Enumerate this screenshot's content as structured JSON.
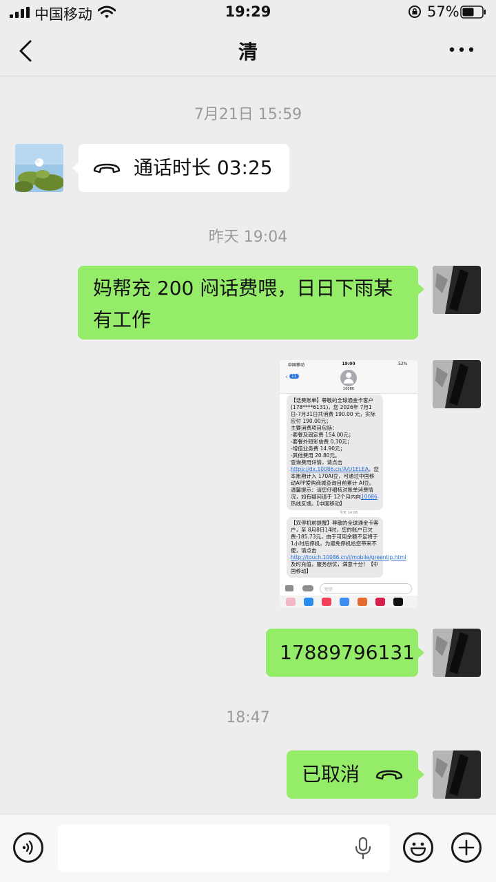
{
  "status_bar": {
    "carrier": "中国移动",
    "time": "19:29",
    "battery": "57%"
  },
  "header": {
    "title": "清"
  },
  "messages": [
    {
      "type": "timestamp",
      "text": "7月21日 15:59"
    },
    {
      "type": "call",
      "side": "left",
      "text": "通话时长 03:25",
      "icon": "phone-hangup-icon"
    },
    {
      "type": "timestamp",
      "text": "昨天 19:04"
    },
    {
      "type": "text",
      "side": "right",
      "text": "妈帮充 200 闷话费喂，日日下雨某有工作"
    },
    {
      "type": "image",
      "side": "right"
    },
    {
      "type": "text",
      "side": "right",
      "text": "17889796131"
    },
    {
      "type": "timestamp",
      "text": "18:47"
    },
    {
      "type": "call",
      "side": "right",
      "text": "已取消",
      "icon": "phone-hangup-icon"
    }
  ],
  "embedded_screenshot": {
    "status_carrier": "中国移动",
    "status_time": "19:00",
    "status_battery": "52%",
    "back_count": "11",
    "contact": "10086",
    "sms1_a": "【话费账单】尊敬的全球通金卡客户 (178****6131)，您 2026年 7月1日-7月31日共消费 190.00 元，实际应付 190.00元；",
    "sms1_b": "主要消费项目包括：",
    "sms1_c": "-套餐及固定费 154.00元；",
    "sms1_d": "-套餐外短彩信费 0.30元；",
    "sms1_e": "-增值业务费 14.90元；",
    "sms1_f": "-其他费用 20.80元。",
    "sms1_g": "查询费用详情，请点击",
    "sms1_link": "https://dx.10086.cn/A/U1ELEA",
    "sms1_h": "。您本账期计入 170AI豆，可通过中国移动APP爱购商城查询目前累计 AI豆。温馨提示：请您仔细核对账单消费情况，如有疑问请于 12个月内向",
    "sms1_link2": "10086",
    "sms1_i": "热线反馈。【中国移动】",
    "divider": "今天 14:08",
    "sms2_a": "【双停机前提醒】尊敬的全球通金卡客户，至 8月8日14时，您的账户已欠费-185.73元，由于可用余额不足将于 1小时后停机，为避免停机给您带来不便，请点击",
    "sms2_link": "http://touch.10086.cn/i/mobile/greentip.html",
    "sms2_b": "及时充值，服务创优，满意十分！【中国移动】",
    "input_placeholder": "短信"
  },
  "bottom_bar": {
    "input_value": ""
  }
}
